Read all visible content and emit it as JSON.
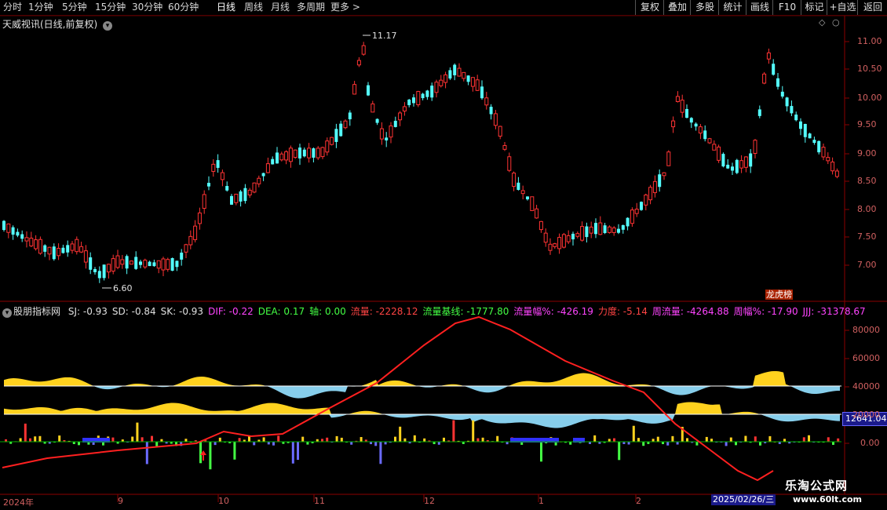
{
  "toolbar": {
    "periods": [
      "分时",
      "1分钟",
      "5分钟",
      "15分钟",
      "30分钟",
      "60分钟",
      "日线",
      "周线",
      "月线",
      "多周期",
      "更多 >"
    ],
    "active_period": "日线",
    "right_buttons": [
      "复权",
      "叠加",
      "多股",
      "统计",
      "画线",
      "F10",
      "标记",
      "+自选",
      "返回"
    ]
  },
  "main_panel": {
    "title": "天威视讯(日线,前复权)",
    "high_label": "11.17",
    "low_label": "6.60",
    "mark_tag": "龙虎榜",
    "y_ticks": [
      "11.00",
      "10.50",
      "10.00",
      "9.50",
      "9.00",
      "8.50",
      "8.00",
      "7.50",
      "7.00"
    ]
  },
  "indicator_panel": {
    "name": "股朋指标网",
    "values": [
      {
        "text": "SJ: -0.93",
        "color": "#e0e0e0"
      },
      {
        "text": "SD: -0.84",
        "color": "#e0e0e0"
      },
      {
        "text": "SK: -0.93",
        "color": "#e0e0e0"
      },
      {
        "text": "DIF: -0.22",
        "color": "#ff44ff"
      },
      {
        "text": "DEA: 0.17",
        "color": "#44ff44"
      },
      {
        "text": "轴: 0.00",
        "color": "#44ff44"
      },
      {
        "text": "流量: -2228.12",
        "color": "#ff4444"
      },
      {
        "text": "流量基线: -1777.80",
        "color": "#44ff44"
      },
      {
        "text": "流量幅%: -426.19",
        "color": "#ff44ff"
      },
      {
        "text": "力度: -5.14",
        "color": "#ff4444"
      },
      {
        "text": "周流量: -4264.88",
        "color": "#ff44ff"
      },
      {
        "text": "周幅%: -17.90",
        "color": "#ff44ff"
      },
      {
        "text": "JJJ: -31378.67",
        "color": "#ff44ff"
      }
    ],
    "y_ticks": [
      "80000",
      "60000",
      "40000",
      "20000",
      "0.00"
    ],
    "value_tag": "12641.04"
  },
  "date_axis": {
    "labels": [
      "2024年",
      "9",
      "10",
      "11",
      "12",
      "1",
      "2"
    ],
    "cursor_date": "2025/02/26/三"
  },
  "watermark": {
    "line1": "乐淘公式网",
    "line2": "www.60lt.com"
  },
  "colors": {
    "up": "#ff3333",
    "down": "#54ffff",
    "yellow": "#ffd21e",
    "lightblue": "#87ceeb",
    "axis": "#8b0000"
  }
}
